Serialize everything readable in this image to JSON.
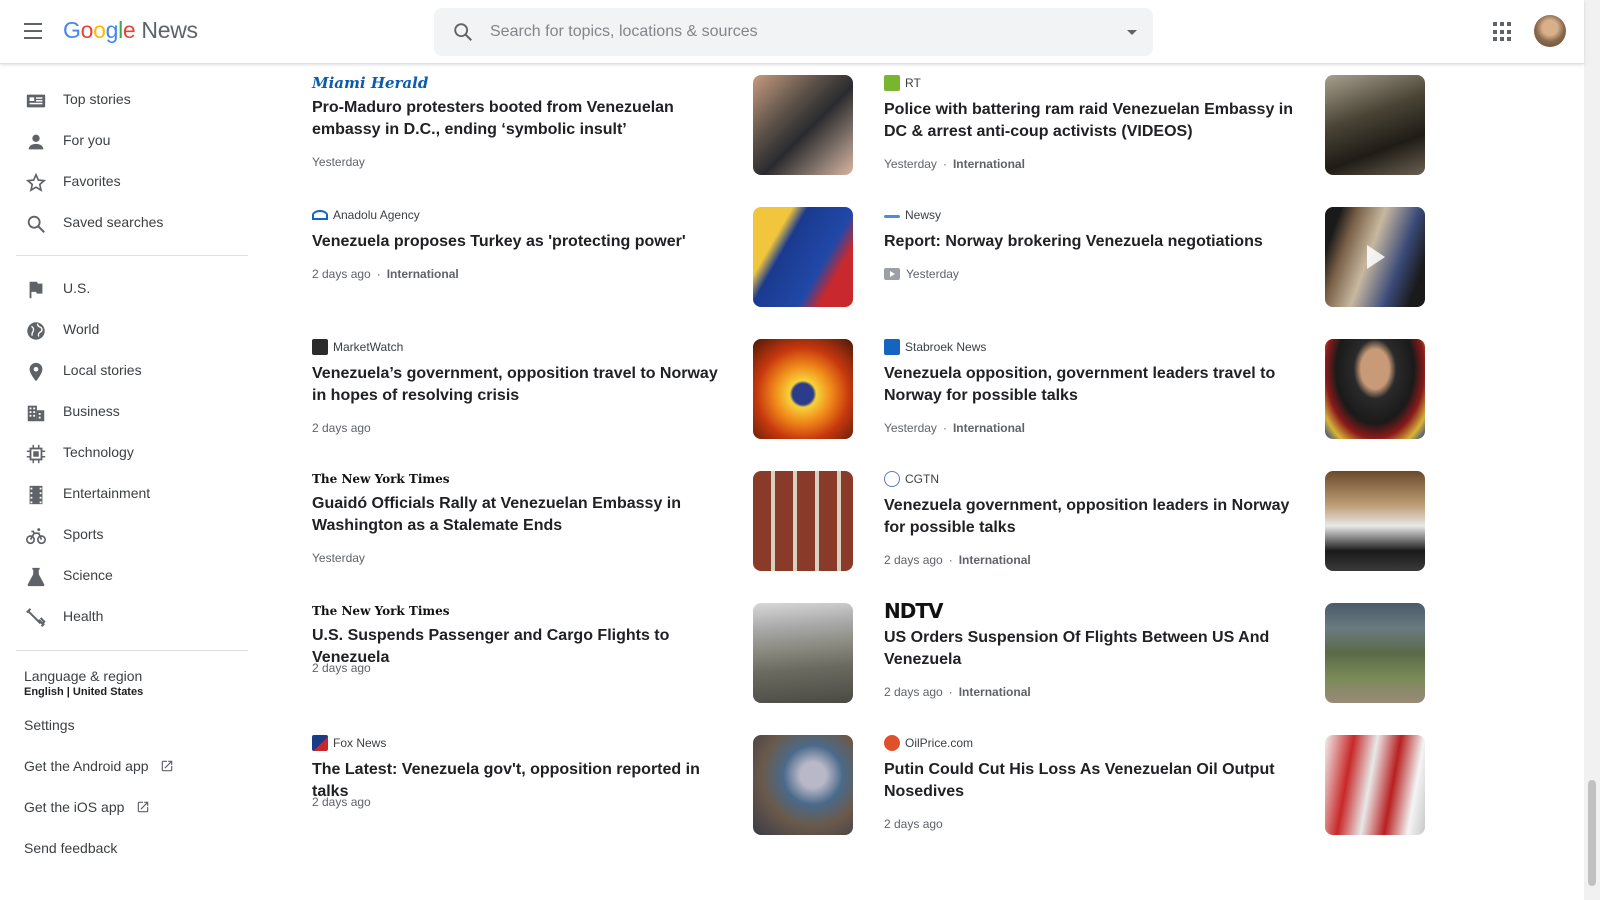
{
  "header": {
    "logo_google": [
      "G",
      "o",
      "o",
      "g",
      "l",
      "e"
    ],
    "logo_news": "News",
    "search_placeholder": "Search for topics, locations & sources"
  },
  "sidebar": {
    "items": [
      {
        "label": "Top stories",
        "icon": "top-stories-icon"
      },
      {
        "label": "For you",
        "icon": "person-icon"
      },
      {
        "label": "Favorites",
        "icon": "star-icon"
      },
      {
        "label": "Saved searches",
        "icon": "search-icon"
      },
      {
        "label": "U.S.",
        "icon": "flag-icon"
      },
      {
        "label": "World",
        "icon": "globe-icon"
      },
      {
        "label": "Local stories",
        "icon": "location-pin-icon"
      },
      {
        "label": "Business",
        "icon": "building-icon"
      },
      {
        "label": "Technology",
        "icon": "chip-icon"
      },
      {
        "label": "Entertainment",
        "icon": "film-icon"
      },
      {
        "label": "Sports",
        "icon": "bicycle-icon"
      },
      {
        "label": "Science",
        "icon": "flask-icon"
      },
      {
        "label": "Health",
        "icon": "health-icon"
      }
    ],
    "language_label": "Language & region",
    "language_value": "English | United States",
    "settings": "Settings",
    "android_app": "Get the Android app",
    "ios_app": "Get the iOS app",
    "feedback": "Send feedback"
  },
  "articles": [
    {
      "source": "Miami Herald",
      "title": "Pro-Maduro protesters booted from Venezuelan embassy in D.C., ending ‘symbolic insult’",
      "time": "Yesterday",
      "category": ""
    },
    {
      "source": "RT",
      "title": "Police with battering ram raid Venezuelan Embassy in DC & arrest anti-coup activists (VIDEOS)",
      "time": "Yesterday",
      "category": "International"
    },
    {
      "source": "Anadolu Agency",
      "title": "Venezuela proposes Turkey as 'protecting power'",
      "time": "2 days ago",
      "category": "International"
    },
    {
      "source": "Newsy",
      "title": "Report: Norway brokering Venezuela negotiations",
      "time": "Yesterday",
      "category": ""
    },
    {
      "source": "MarketWatch",
      "title": "Venezuela’s government, opposition travel to Norway in hopes of resolving crisis",
      "time": "2 days ago",
      "category": ""
    },
    {
      "source": "Stabroek News",
      "title": "Venezuela opposition, government leaders travel to Norway for possible talks",
      "time": "Yesterday",
      "category": "International"
    },
    {
      "source": "The New York Times",
      "title": "Guaidó Officials Rally at Venezuelan Embassy in Washington as a Stalemate Ends",
      "time": "Yesterday",
      "category": ""
    },
    {
      "source": "CGTN",
      "title": "Venezuela government, opposition leaders in Norway for possible talks",
      "time": "2 days ago",
      "category": "International"
    },
    {
      "source": "The New York Times",
      "title": "U.S. Suspends Passenger and Cargo Flights to Venezuela",
      "time": "2 days ago",
      "category": ""
    },
    {
      "source": "NDTV",
      "title": "US Orders Suspension Of Flights Between US And Venezuela",
      "time": "2 days ago",
      "category": "International"
    },
    {
      "source": "Fox News",
      "title": "The Latest: Venezuela gov't, opposition reported in talks",
      "time": "2 days ago",
      "category": ""
    },
    {
      "source": "OilPrice.com",
      "title": "Putin Could Cut His Loss As Venezuelan Oil Output Nosedives",
      "time": "2 days ago",
      "category": ""
    }
  ],
  "colors": {
    "accent_blue": "#4285f4",
    "title_text": "#202124",
    "meta_text": "#5f6368"
  }
}
